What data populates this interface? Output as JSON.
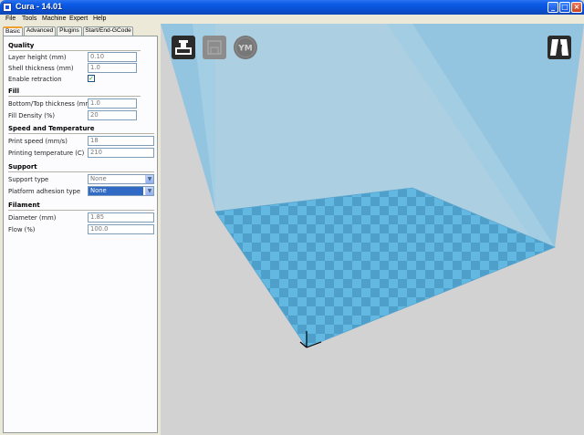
{
  "window": {
    "title": "Cura - 14.01",
    "minimize_glyph": "_",
    "maximize_glyph": "□",
    "close_glyph": "×"
  },
  "menu": [
    "File",
    "Tools",
    "Machine",
    "Expert",
    "Help"
  ],
  "tabs": [
    "Basic",
    "Advanced",
    "Plugins",
    "Start/End-GCode"
  ],
  "sections": {
    "quality": {
      "title": "Quality",
      "layer_height": {
        "label": "Layer height (mm)",
        "value": "0.10"
      },
      "shell_thickness": {
        "label": "Shell thickness (mm)",
        "value": "1.0"
      },
      "enable_retraction": {
        "label": "Enable retraction",
        "checked": "✓"
      }
    },
    "fill": {
      "title": "Fill",
      "bottom_top_thickness": {
        "label": "Bottom/Top thickness (mm)",
        "value": "1.0"
      },
      "fill_density": {
        "label": "Fill Density (%)",
        "value": "20"
      }
    },
    "speed": {
      "title": "Speed and Temperature",
      "print_speed": {
        "label": "Print speed (mm/s)",
        "value": "18"
      },
      "printing_temperature": {
        "label": "Printing temperature (C)",
        "value": "210"
      }
    },
    "support": {
      "title": "Support",
      "support_type": {
        "label": "Support type",
        "value": "None"
      },
      "platform_adhesion": {
        "label": "Platform adhesion type",
        "value": "None"
      }
    },
    "filament": {
      "title": "Filament",
      "diameter": {
        "label": "Diameter (mm)",
        "value": "1.85"
      },
      "flow": {
        "label": "Flow (%)",
        "value": "100.0"
      }
    }
  },
  "viewport": {
    "ym_label": "YM",
    "colors": {
      "background": "#d2d2d2",
      "volume": "#8fc4e0",
      "bed_light": "#63b8e2",
      "bed_dark": "#4e9fc9"
    },
    "icons": [
      "load-model-icon",
      "save-sd-icon",
      "youmagine-icon",
      "view-mode-icon"
    ]
  }
}
